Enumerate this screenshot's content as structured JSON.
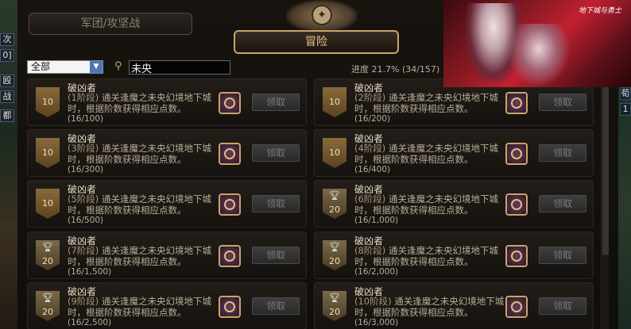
{
  "tabs": {
    "siege": "军团/攻坚战",
    "adventure": "冒险"
  },
  "filter": {
    "selected": "全部"
  },
  "search": {
    "value": "未央"
  },
  "progress": {
    "label": "进度",
    "value": "21.7% (34/157)"
  },
  "claim_label": "领取",
  "cards": [
    {
      "title": "破凶者",
      "level": "10",
      "stage": "(1阶段)",
      "text": "通关逢魔之未央幻境地下城时，根据阶数获得相应点数。",
      "count": "(16/100)"
    },
    {
      "title": "破凶者",
      "level": "10",
      "stage": "(2阶段)",
      "text": "通关逢魔之未央幻境地下城时，根据阶数获得相应点数。",
      "count": "(16/200)"
    },
    {
      "title": "破凶者",
      "level": "10",
      "stage": "(3阶段)",
      "text": "通关逢魔之未央幻境地下城时，根据阶数获得相应点数。",
      "count": "(16/300)"
    },
    {
      "title": "破凶者",
      "level": "10",
      "stage": "(4阶段)",
      "text": "通关逢魔之未央幻境地下城时，根据阶数获得相应点数。",
      "count": "(16/400)"
    },
    {
      "title": "破凶者",
      "level": "10",
      "stage": "(5阶段)",
      "text": "通关逢魔之未央幻境地下城时，根据阶数获得相应点数。",
      "count": "(16/500)"
    },
    {
      "title": "破凶者",
      "level": "20",
      "stage": "(6阶段)",
      "text": "通关逢魔之未央幻境地下城时，根据阶数获得相应点数。",
      "count": "(16/1,000)"
    },
    {
      "title": "破凶者",
      "level": "20",
      "stage": "(7阶段)",
      "text": "通关逢魔之未央幻境地下城时，根据阶数获得相应点数。",
      "count": "(16/1,500)"
    },
    {
      "title": "破凶者",
      "level": "20",
      "stage": "(8阶段)",
      "text": "通关逢魔之未央幻境地下城时，根据阶数获得相应点数。",
      "count": "(16/2,000)"
    },
    {
      "title": "破凶者",
      "level": "20",
      "stage": "(9阶段)",
      "text": "通关逢魔之未央幻境地下城时，根据阶数获得相应点数。",
      "count": "(16/2,500)"
    },
    {
      "title": "破凶者",
      "level": "20",
      "stage": "(10阶段)",
      "text": "通关逢魔之未央幻境地下城时，根据阶数获得相应点数。",
      "count": "(16/3,000)"
    }
  ],
  "left_chips": [
    "次",
    "0]",
    "殴",
    "战",
    "都"
  ],
  "right_chips": [
    "荀",
    "1"
  ],
  "banner": {
    "logo": "地下城与勇士"
  },
  "colors": {
    "accent_gold": "#c9a46a",
    "card_bg": "#1d1915",
    "search_icon": "#c9a46a"
  }
}
